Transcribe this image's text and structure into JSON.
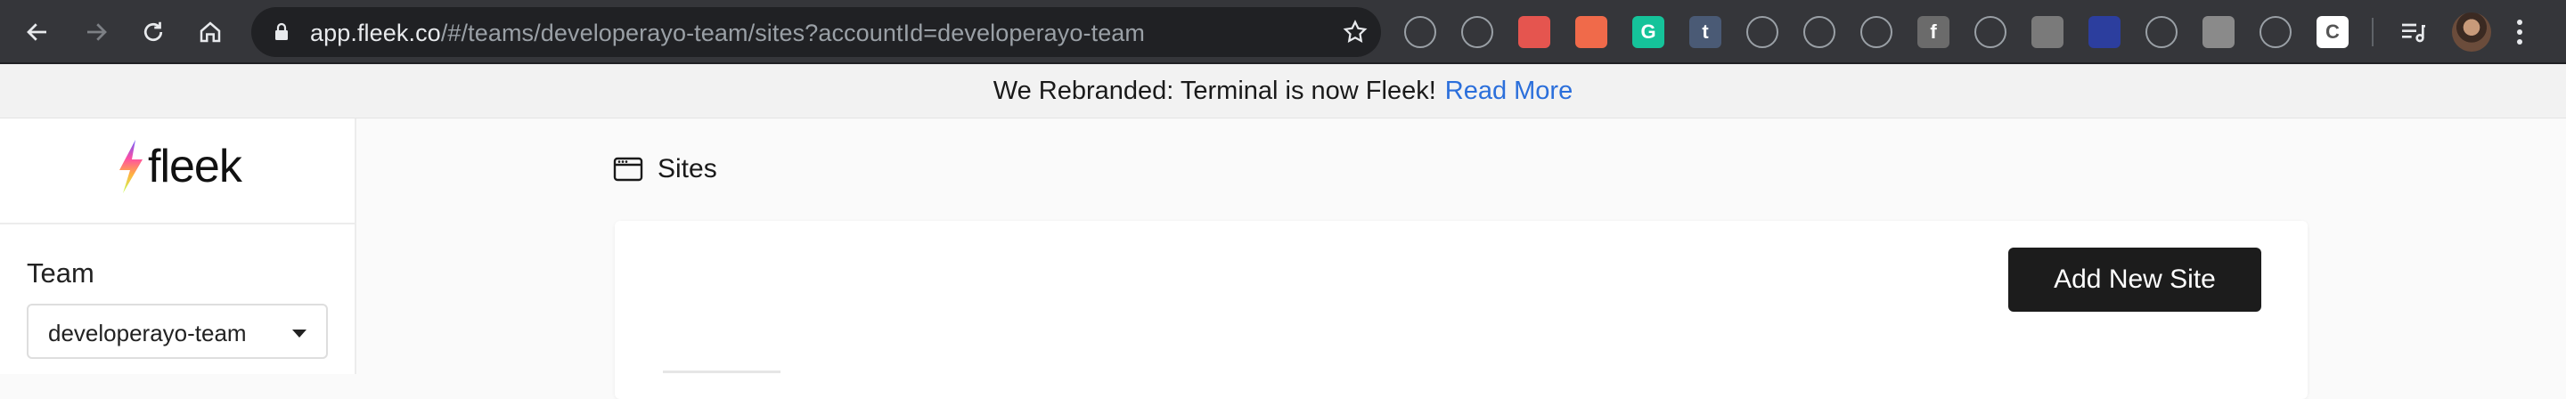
{
  "browser": {
    "url_host": "app.fleek.co",
    "url_path": "/#/teams/developerayo-team/sites?accountId=developerayo-team",
    "nav_icons": [
      "back-icon",
      "forward-icon",
      "reload-icon",
      "home-icon"
    ],
    "extensions": [
      {
        "name": "eyedropper-extension-icon",
        "color": "#35363a"
      },
      {
        "name": "react-devtools-extension-icon",
        "color": "#35363a"
      },
      {
        "name": "video-extension-icon",
        "color": "#e5554f"
      },
      {
        "name": "avatar-extension-icon",
        "color": "#f06a4a"
      },
      {
        "name": "grammarly-extension-icon",
        "color": "#15c39a",
        "glyph": "G"
      },
      {
        "name": "tumblr-extension-icon",
        "color": "#4a5a75",
        "glyph": "t"
      },
      {
        "name": "puzzle-extension-icon",
        "color": "#35363a"
      },
      {
        "name": "diamond-extension-icon",
        "color": "#35363a"
      },
      {
        "name": "camera-extension-icon",
        "color": "#35363a"
      },
      {
        "name": "facebook-extension-icon",
        "color": "#6b6b6b",
        "glyph": "f"
      },
      {
        "name": "crop-extension-icon",
        "color": "#35363a"
      },
      {
        "name": "dots-extension-icon",
        "color": "#7a7a7a"
      },
      {
        "name": "cursor-extension-icon",
        "color": "#2c3e9e"
      },
      {
        "name": "spiral-extension-icon",
        "color": "#35363a"
      },
      {
        "name": "clock-extension-icon",
        "color": "#8a8a8a"
      },
      {
        "name": "thumbs-up-extension-icon",
        "color": "#35363a"
      },
      {
        "name": "clipboard-extension-icon",
        "color": "#ffffff",
        "glyph": "C"
      }
    ]
  },
  "banner": {
    "text": "We Rebranded: Terminal is now Fleek!",
    "link": "Read More"
  },
  "sidebar": {
    "logo_text": "fleek",
    "team_label": "Team",
    "team_value": "developerayo-team"
  },
  "main": {
    "title": "Sites",
    "add_button": "Add New Site"
  },
  "colors": {
    "link": "#2b6fdb",
    "button_bg": "#1c1c1c",
    "chrome_bg": "#35363a"
  }
}
